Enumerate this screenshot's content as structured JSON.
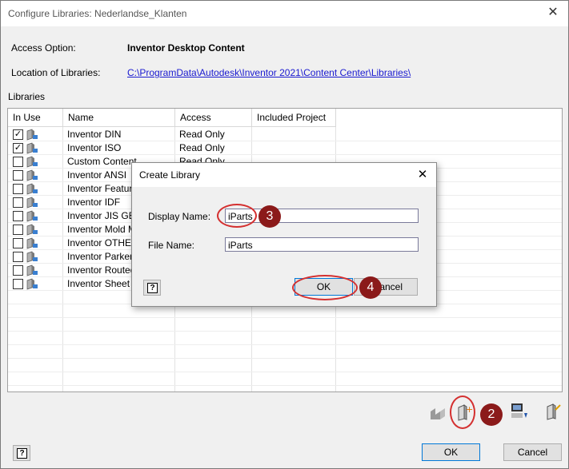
{
  "window": {
    "title": "Configure Libraries: Nederlandse_Klanten"
  },
  "access_option": {
    "label": "Access Option:",
    "value": "Inventor Desktop Content"
  },
  "location": {
    "label": "Location of Libraries:",
    "path": "C:\\ProgramData\\Autodesk\\Inventor 2021\\Content Center\\Libraries\\"
  },
  "libraries": {
    "group_label": "Libraries",
    "columns": [
      "In Use",
      "Name",
      "Access",
      "Included Project"
    ],
    "rows": [
      {
        "checked": true,
        "name": "Inventor DIN",
        "access": "Read Only"
      },
      {
        "checked": true,
        "name": "Inventor ISO",
        "access": "Read Only"
      },
      {
        "checked": false,
        "name": "Custom Content",
        "access": "Read Only"
      },
      {
        "checked": false,
        "name": "Inventor ANSI",
        "access": ""
      },
      {
        "checked": false,
        "name": "Inventor Feature",
        "access": ""
      },
      {
        "checked": false,
        "name": "Inventor IDF",
        "access": ""
      },
      {
        "checked": false,
        "name": "Inventor JIS GB",
        "access": ""
      },
      {
        "checked": false,
        "name": "Inventor Mold Me",
        "access": ""
      },
      {
        "checked": false,
        "name": "Inventor OTHER",
        "access": ""
      },
      {
        "checked": false,
        "name": "Inventor Parker",
        "access": ""
      },
      {
        "checked": false,
        "name": "Inventor Routed",
        "access": ""
      },
      {
        "checked": false,
        "name": "Inventor Sheet M",
        "access": ""
      }
    ]
  },
  "dialog": {
    "title": "Create Library",
    "display_name_label": "Display Name:",
    "display_name_value": "iParts",
    "file_name_label": "File Name:",
    "file_name_value": "iParts",
    "ok_label": "OK",
    "cancel_label": "Cancel",
    "cancel_visible": "ancel"
  },
  "callouts": {
    "step2": "2",
    "step3": "3",
    "step4": "4"
  },
  "footer": {
    "ok_label": "OK",
    "cancel_label": "Cancel"
  },
  "toolbar_icons": [
    "remove-library-icon",
    "create-library-icon",
    "import-library-icon",
    "library-properties-icon"
  ],
  "colors": {
    "badge": "#8b1a1a",
    "highlight_ring": "#d43030",
    "link": "#1a1ad0"
  }
}
